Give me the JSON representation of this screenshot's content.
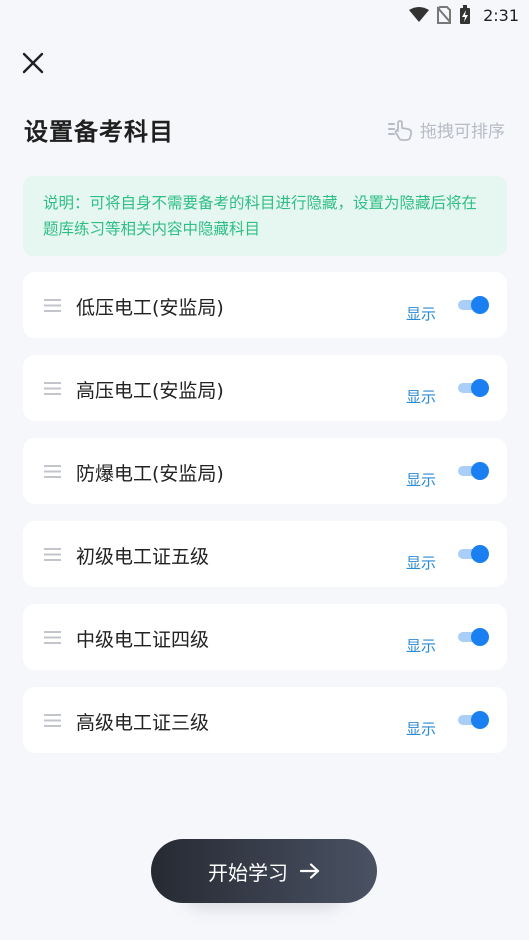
{
  "statusbar": {
    "time": "2:31"
  },
  "header": {
    "title": "设置备考科目",
    "drag_sort_label": "拖拽可排序"
  },
  "notice": {
    "text": "说明：可将自身不需要备考的科目进行隐藏，设置为隐藏后将在题库练习等相关内容中隐藏科目"
  },
  "subjects": [
    {
      "name": "低压电工(安监局)",
      "state": "显示",
      "visible": true
    },
    {
      "name": "高压电工(安监局)",
      "state": "显示",
      "visible": true
    },
    {
      "name": "防爆电工(安监局)",
      "state": "显示",
      "visible": true
    },
    {
      "name": "初级电工证五级",
      "state": "显示",
      "visible": true
    },
    {
      "name": "中级电工证四级",
      "state": "显示",
      "visible": true
    },
    {
      "name": "高级电工证三级",
      "state": "显示",
      "visible": true
    }
  ],
  "footer": {
    "start_label": "开始学习"
  },
  "colors": {
    "accent": "#1a80f1",
    "notice_bg": "#e6f6f1",
    "notice_text": "#2fbf86",
    "state_text": "#2b8ad4"
  }
}
